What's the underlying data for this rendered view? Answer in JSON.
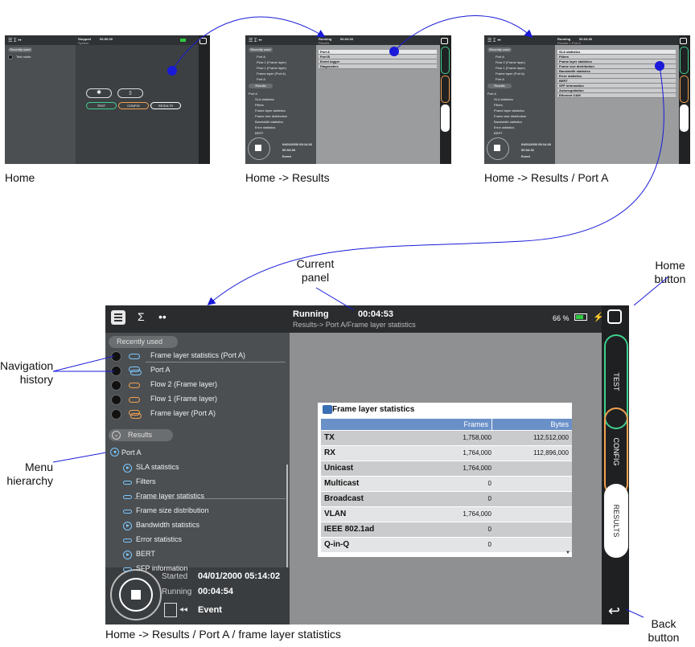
{
  "captions": {
    "home": "Home",
    "results": "Home -> Results",
    "port_a": "Home -> Results / Port A",
    "main": "Home -> Results / Port A / frame layer statistics"
  },
  "labels": {
    "current_panel": "Current panel",
    "home_button": "Home button",
    "navigation_history": "Navigation history",
    "menu_hierarchy": "Menu hierarchy",
    "back_button": "Back button"
  },
  "thumb_home": {
    "status": "Stopped",
    "time": "00:00:00",
    "sub": "System",
    "recently_used": "Recently used",
    "test_mode": "Test mode",
    "buttons": [
      "TEST",
      "CONFIG",
      "RESULTS"
    ]
  },
  "thumb_results": {
    "status": "Running",
    "time": "00:04:03",
    "sub": "Results",
    "menu": [
      "Port A",
      "Port B",
      "Event logger",
      "Diagnostics"
    ],
    "recent": [
      "Port A",
      "Flow 2 (Frame layer)",
      "Flow 1 (Frame layer)",
      "Frame layer (Port A)",
      "Port A"
    ],
    "results_pill": "Results",
    "tree": [
      "Port A",
      "SLA statistics",
      "Filters",
      "Frame layer statistics",
      "Frame size distribution",
      "Bandwidth statistics",
      "Error statistics",
      "BERT"
    ],
    "started": "04/01/2000 05:14:02",
    "running": "00:04:03",
    "event": "Event"
  },
  "thumb_porta": {
    "status": "Running",
    "time": "00:04:30",
    "sub": "Results > Port A",
    "menu": [
      "SLA statistics",
      "Filters",
      "Frame layer statistics",
      "Frame size distribution",
      "Bandwidth statistics",
      "Error statistics",
      "BERT",
      "SFP information",
      "Autonegotiation",
      "Ethernet OAM"
    ],
    "recent": [
      "Port A",
      "Flow 2 (Frame layer)",
      "Flow 1 (Frame layer)",
      "Frame layer (Port A)",
      "Port A"
    ],
    "results_pill": "Results",
    "tree": [
      "Port A",
      "SLA statistics",
      "Filters",
      "Frame layer statistics",
      "Frame size distribution",
      "Bandwidth statistics",
      "Error statistics",
      "BERT"
    ],
    "started": "04/01/2000 05:14:02",
    "running": "00:04:31",
    "event": "Event"
  },
  "main": {
    "status": "Running",
    "time": "00:04:53",
    "breadcrumb": "Results-> Port A/Frame layer statistics",
    "battery": "66 %",
    "recently_used": "Recently used",
    "recent": [
      {
        "label": "Frame layer statistics (Port A)",
        "color": "#7cc7ff"
      },
      {
        "label": "Port A",
        "color": "#7cc7ff"
      },
      {
        "label": "Flow 2 (Frame layer)",
        "color": "#f0a050"
      },
      {
        "label": "Flow 1 (Frame layer)",
        "color": "#f0a050"
      },
      {
        "label": "Frame layer (Port A)",
        "color": "#f0a050"
      }
    ],
    "results_pill": "Results",
    "tree_root": "Port A",
    "tree": [
      {
        "label": "SLA statistics",
        "icon": "expand"
      },
      {
        "label": "Filters",
        "icon": "flat"
      },
      {
        "label": "Frame layer statistics",
        "icon": "flat"
      },
      {
        "label": "Frame size distribution",
        "icon": "flat"
      },
      {
        "label": "Bandwidth statistics",
        "icon": "expand"
      },
      {
        "label": "Error statistics",
        "icon": "flat"
      },
      {
        "label": "BERT",
        "icon": "expand"
      },
      {
        "label": "SFP information",
        "icon": "flat"
      }
    ],
    "started_label": "Started",
    "started": "04/01/2000 05:14:02",
    "running_label": "Running",
    "running": "00:04:54",
    "event": "Event",
    "side_buttons": [
      {
        "label": "TEST",
        "color": "#3fcf8e"
      },
      {
        "label": "CONFIG",
        "color": "#f0a050"
      },
      {
        "label": "RESULTS",
        "color": "#ffffff"
      }
    ],
    "table": {
      "title": "Frame layer statistics",
      "columns": [
        "Frames",
        "Bytes"
      ],
      "rows": [
        {
          "label": "TX",
          "frames": "1,758,000",
          "bytes": "112,512,000"
        },
        {
          "label": "RX",
          "frames": "1,764,000",
          "bytes": "112,896,000"
        },
        {
          "label": "Unicast",
          "frames": "1,764,000",
          "bytes": ""
        },
        {
          "label": "Multicast",
          "frames": "0",
          "bytes": ""
        },
        {
          "label": "Broadcast",
          "frames": "0",
          "bytes": ""
        },
        {
          "label": "VLAN",
          "frames": "1,764,000",
          "bytes": ""
        },
        {
          "label": "IEEE 802.1ad",
          "frames": "0",
          "bytes": ""
        },
        {
          "label": "Q-in-Q",
          "frames": "0",
          "bytes": ""
        }
      ]
    }
  },
  "colors": {
    "arrow": "#1a1ad8",
    "selected_dot": "#1a1ad8",
    "table_header": "#6a90c8",
    "test": "#3fcf8e",
    "config": "#f0a050",
    "battery": "#2ecc40"
  }
}
